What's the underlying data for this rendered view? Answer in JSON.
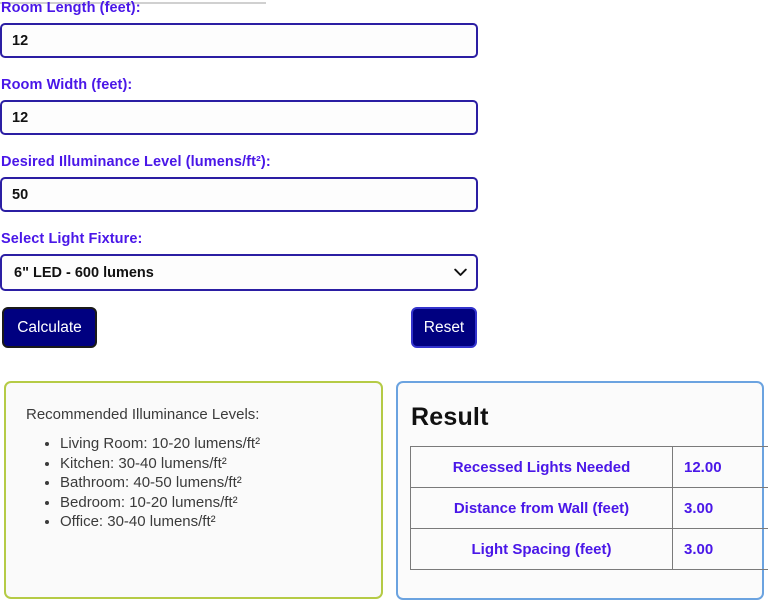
{
  "form": {
    "fields": [
      {
        "label": "Room Length (feet):",
        "value": "12",
        "placeholder": ""
      },
      {
        "label": "Room Width (feet):",
        "value": "12",
        "placeholder": ""
      },
      {
        "label": "Desired Illuminance Level (lumens/ft²):",
        "value": "50",
        "placeholder": ""
      }
    ],
    "select": {
      "label": "Select Light Fixture:",
      "value": "6\" LED - 600 lumens",
      "chevron_icon": "chevron-down-icon"
    },
    "buttons": {
      "calculate": "Calculate",
      "reset": "Reset"
    }
  },
  "recommendations": {
    "title": "Recommended Illuminance Levels:",
    "items": [
      "Living Room: 10-20 lumens/ft²",
      "Kitchen: 30-40 lumens/ft²",
      "Bathroom: 40-50 lumens/ft²",
      "Bedroom: 10-20 lumens/ft²",
      "Office: 30-40 lumens/ft²"
    ],
    "border_color": "#b5cb46"
  },
  "result": {
    "title": "Result",
    "border_color": "#6ba3e0",
    "rows": [
      {
        "label": "Recessed Lights Needed",
        "value": "12.00"
      },
      {
        "label": "Distance from Wall (feet)",
        "value": "3.00"
      },
      {
        "label": "Light Spacing (feet)",
        "value": "3.00"
      }
    ]
  },
  "colors": {
    "label_text": "#4a17e8",
    "input_border": "#2b1ea3",
    "button_bg": "#000080",
    "body_text": "#3b3b3b"
  }
}
